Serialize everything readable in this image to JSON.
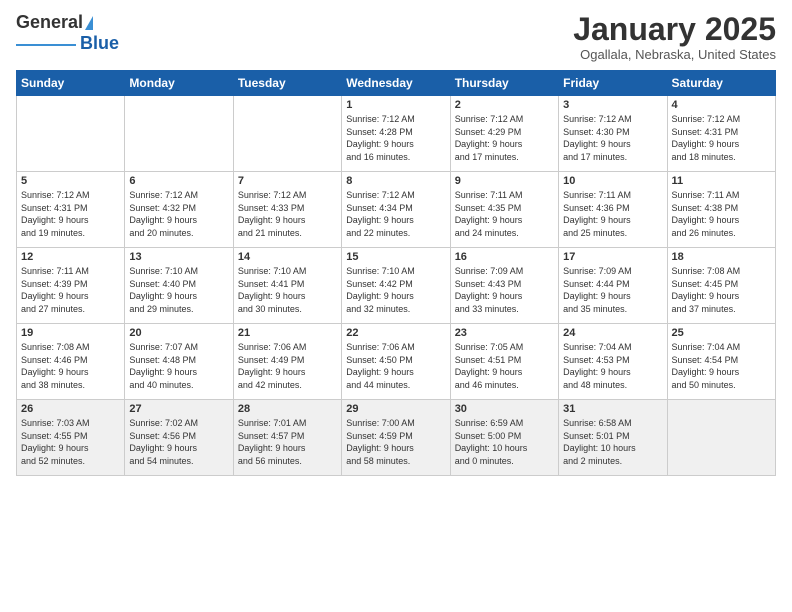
{
  "header": {
    "logo_general": "General",
    "logo_blue": "Blue",
    "month_title": "January 2025",
    "location": "Ogallala, Nebraska, United States"
  },
  "weekdays": [
    "Sunday",
    "Monday",
    "Tuesday",
    "Wednesday",
    "Thursday",
    "Friday",
    "Saturday"
  ],
  "weeks": [
    [
      {
        "day": "",
        "info": ""
      },
      {
        "day": "",
        "info": ""
      },
      {
        "day": "",
        "info": ""
      },
      {
        "day": "1",
        "info": "Sunrise: 7:12 AM\nSunset: 4:28 PM\nDaylight: 9 hours\nand 16 minutes."
      },
      {
        "day": "2",
        "info": "Sunrise: 7:12 AM\nSunset: 4:29 PM\nDaylight: 9 hours\nand 17 minutes."
      },
      {
        "day": "3",
        "info": "Sunrise: 7:12 AM\nSunset: 4:30 PM\nDaylight: 9 hours\nand 17 minutes."
      },
      {
        "day": "4",
        "info": "Sunrise: 7:12 AM\nSunset: 4:31 PM\nDaylight: 9 hours\nand 18 minutes."
      }
    ],
    [
      {
        "day": "5",
        "info": "Sunrise: 7:12 AM\nSunset: 4:31 PM\nDaylight: 9 hours\nand 19 minutes."
      },
      {
        "day": "6",
        "info": "Sunrise: 7:12 AM\nSunset: 4:32 PM\nDaylight: 9 hours\nand 20 minutes."
      },
      {
        "day": "7",
        "info": "Sunrise: 7:12 AM\nSunset: 4:33 PM\nDaylight: 9 hours\nand 21 minutes."
      },
      {
        "day": "8",
        "info": "Sunrise: 7:12 AM\nSunset: 4:34 PM\nDaylight: 9 hours\nand 22 minutes."
      },
      {
        "day": "9",
        "info": "Sunrise: 7:11 AM\nSunset: 4:35 PM\nDaylight: 9 hours\nand 24 minutes."
      },
      {
        "day": "10",
        "info": "Sunrise: 7:11 AM\nSunset: 4:36 PM\nDaylight: 9 hours\nand 25 minutes."
      },
      {
        "day": "11",
        "info": "Sunrise: 7:11 AM\nSunset: 4:38 PM\nDaylight: 9 hours\nand 26 minutes."
      }
    ],
    [
      {
        "day": "12",
        "info": "Sunrise: 7:11 AM\nSunset: 4:39 PM\nDaylight: 9 hours\nand 27 minutes."
      },
      {
        "day": "13",
        "info": "Sunrise: 7:10 AM\nSunset: 4:40 PM\nDaylight: 9 hours\nand 29 minutes."
      },
      {
        "day": "14",
        "info": "Sunrise: 7:10 AM\nSunset: 4:41 PM\nDaylight: 9 hours\nand 30 minutes."
      },
      {
        "day": "15",
        "info": "Sunrise: 7:10 AM\nSunset: 4:42 PM\nDaylight: 9 hours\nand 32 minutes."
      },
      {
        "day": "16",
        "info": "Sunrise: 7:09 AM\nSunset: 4:43 PM\nDaylight: 9 hours\nand 33 minutes."
      },
      {
        "day": "17",
        "info": "Sunrise: 7:09 AM\nSunset: 4:44 PM\nDaylight: 9 hours\nand 35 minutes."
      },
      {
        "day": "18",
        "info": "Sunrise: 7:08 AM\nSunset: 4:45 PM\nDaylight: 9 hours\nand 37 minutes."
      }
    ],
    [
      {
        "day": "19",
        "info": "Sunrise: 7:08 AM\nSunset: 4:46 PM\nDaylight: 9 hours\nand 38 minutes."
      },
      {
        "day": "20",
        "info": "Sunrise: 7:07 AM\nSunset: 4:48 PM\nDaylight: 9 hours\nand 40 minutes."
      },
      {
        "day": "21",
        "info": "Sunrise: 7:06 AM\nSunset: 4:49 PM\nDaylight: 9 hours\nand 42 minutes."
      },
      {
        "day": "22",
        "info": "Sunrise: 7:06 AM\nSunset: 4:50 PM\nDaylight: 9 hours\nand 44 minutes."
      },
      {
        "day": "23",
        "info": "Sunrise: 7:05 AM\nSunset: 4:51 PM\nDaylight: 9 hours\nand 46 minutes."
      },
      {
        "day": "24",
        "info": "Sunrise: 7:04 AM\nSunset: 4:53 PM\nDaylight: 9 hours\nand 48 minutes."
      },
      {
        "day": "25",
        "info": "Sunrise: 7:04 AM\nSunset: 4:54 PM\nDaylight: 9 hours\nand 50 minutes."
      }
    ],
    [
      {
        "day": "26",
        "info": "Sunrise: 7:03 AM\nSunset: 4:55 PM\nDaylight: 9 hours\nand 52 minutes."
      },
      {
        "day": "27",
        "info": "Sunrise: 7:02 AM\nSunset: 4:56 PM\nDaylight: 9 hours\nand 54 minutes."
      },
      {
        "day": "28",
        "info": "Sunrise: 7:01 AM\nSunset: 4:57 PM\nDaylight: 9 hours\nand 56 minutes."
      },
      {
        "day": "29",
        "info": "Sunrise: 7:00 AM\nSunset: 4:59 PM\nDaylight: 9 hours\nand 58 minutes."
      },
      {
        "day": "30",
        "info": "Sunrise: 6:59 AM\nSunset: 5:00 PM\nDaylight: 10 hours\nand 0 minutes."
      },
      {
        "day": "31",
        "info": "Sunrise: 6:58 AM\nSunset: 5:01 PM\nDaylight: 10 hours\nand 2 minutes."
      },
      {
        "day": "",
        "info": ""
      }
    ]
  ]
}
